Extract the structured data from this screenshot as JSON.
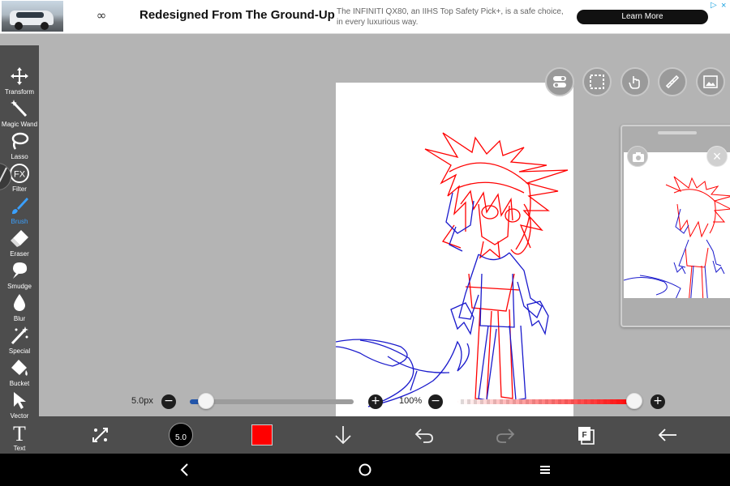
{
  "ad": {
    "logo_glyph": "∞",
    "title": "Redesigned From The Ground-Up",
    "description": "The INFINITI QX80, an IIHS Top Safety Pick+, is a safe choice, in every luxurious way.",
    "cta": "Learn More",
    "adchoices_glyph": "▷",
    "close_glyph": "×"
  },
  "tools": [
    {
      "label": "Transform",
      "icon": "move-icon",
      "active": false
    },
    {
      "label": "Magic Wand",
      "icon": "magic-wand-icon",
      "active": false
    },
    {
      "label": "Lasso",
      "icon": "lasso-icon",
      "active": false
    },
    {
      "label": "Filter",
      "icon": "fx-icon",
      "active": false
    },
    {
      "label": "Brush",
      "icon": "brush-icon",
      "active": true
    },
    {
      "label": "Eraser",
      "icon": "eraser-icon",
      "active": false
    },
    {
      "label": "Smudge",
      "icon": "smudge-icon",
      "active": false
    },
    {
      "label": "Blur",
      "icon": "droplet-icon",
      "active": false
    },
    {
      "label": "Special",
      "icon": "sparkle-icon",
      "active": false
    },
    {
      "label": "Bucket",
      "icon": "bucket-icon",
      "active": false
    },
    {
      "label": "Vector",
      "icon": "cursor-arrow-icon",
      "active": false
    },
    {
      "label": "Text",
      "icon": "text-icon",
      "active": false
    }
  ],
  "filter_icon_text": "FX",
  "text_icon_text": "T",
  "brush_size_slider": {
    "label": "5.0px",
    "value": 0.1
  },
  "opacity_slider": {
    "label": "100%",
    "value": 1.0
  },
  "bottombar": {
    "brush_size": "5.0",
    "color": "#ff0000"
  },
  "floating_buttons": [
    "toggle-icon",
    "selection-icon",
    "hand-icon",
    "ruler-icon",
    "image-icon"
  ],
  "colors": {
    "accent": "#3aa0ff",
    "toolbar": "#4d4d4d",
    "stroke_red": "#ff0000",
    "stroke_blue": "#1a1acc",
    "background": "#b4b4b4"
  },
  "nav": {
    "back": "‹",
    "home": "○",
    "recents": "≡"
  }
}
